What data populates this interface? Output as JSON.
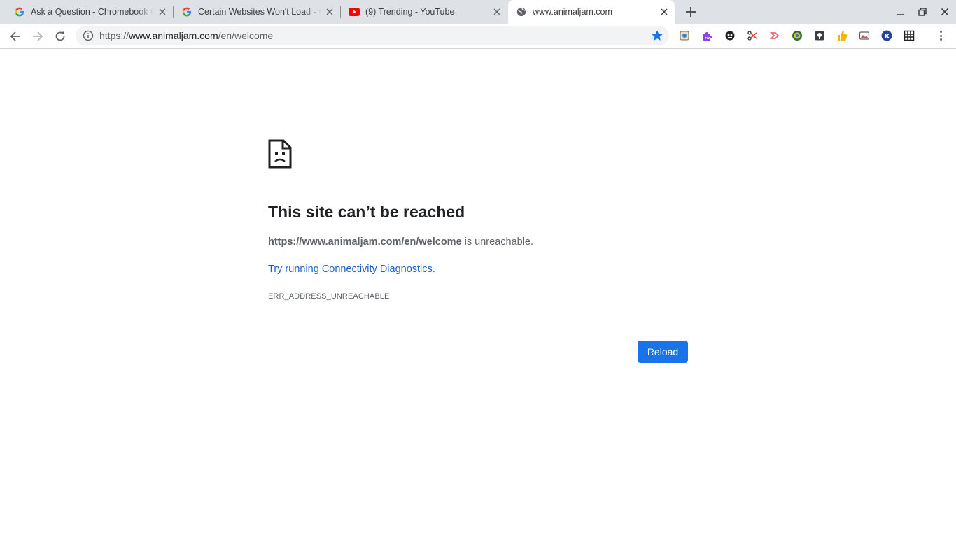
{
  "tabs": [
    {
      "title": "Ask a Question - Chromebook Community",
      "favicon": "google-g-icon"
    },
    {
      "title": "Certain Websites Won't Load - Chromebook Community",
      "favicon": "google-g-icon"
    },
    {
      "title": "(9) Trending - YouTube",
      "favicon": "youtube-icon"
    },
    {
      "title": "www.animaljam.com",
      "favicon": "globe-icon",
      "active": true
    }
  ],
  "omnibox": {
    "scheme": "https://",
    "host": "www.animaljam.com",
    "path": "/en/welcome"
  },
  "extensions": [
    "extension-1-icon",
    "puzzle-rw-icon",
    "extension-3-icon",
    "scissors-icon",
    "extension-5-icon",
    "extension-6-icon",
    "extension-7-icon",
    "thumbs-up-icon",
    "extension-9-icon",
    "k-icon",
    "grid-icon"
  ],
  "error": {
    "title": "This site can’t be reached",
    "url_bold": "https://www.animaljam.com/en/welcome",
    "desc_suffix": " is unreachable.",
    "link": "Try running Connectivity Diagnostics.",
    "code": "ERR_ADDRESS_UNREACHABLE",
    "reload_label": "Reload"
  },
  "colors": {
    "accent": "#1a73e8",
    "link": "#1a5fc5",
    "tabstrip": "#dee1e6"
  }
}
